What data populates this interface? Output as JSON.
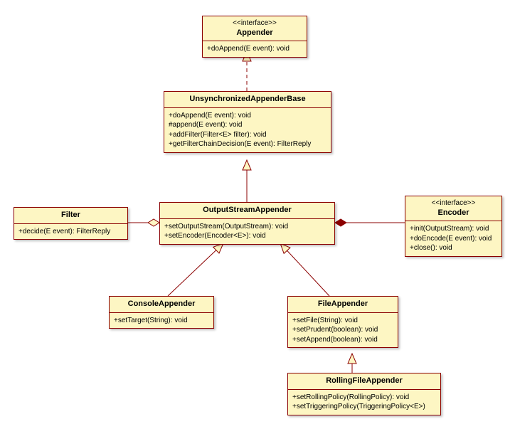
{
  "classes": {
    "appender": {
      "stereotype": "<<interface>>",
      "name": "Appender",
      "ops": [
        "+doAppend(E event): void"
      ]
    },
    "uab": {
      "name": "UnsynchronizedAppenderBase",
      "ops": [
        "+doAppend(E event): void",
        "#append(E event): void",
        "+addFilter(Filter<E> filter): void",
        "+getFilterChainDecision(E event): FilterReply"
      ]
    },
    "osa": {
      "name": "OutputStreamAppender",
      "ops": [
        "+setOutputStream(OutputStream): void",
        "+setEncoder(Encoder<E>): void"
      ]
    },
    "filter": {
      "name": "Filter",
      "ops": [
        "+decide(E event): FilterReply"
      ]
    },
    "encoder": {
      "stereotype": "<<interface>>",
      "name": "Encoder",
      "ops": [
        "+init(OutputStream): void",
        "+doEncode(E event): void",
        "+close(): void"
      ]
    },
    "console": {
      "name": "ConsoleAppender",
      "ops": [
        "+setTarget(String): void"
      ]
    },
    "file": {
      "name": "FileAppender",
      "ops": [
        "+setFile(String): void",
        "+setPrudent(boolean): void",
        "+setAppend(boolean): void"
      ]
    },
    "rolling": {
      "name": "RollingFileAppender",
      "ops": [
        "+setRollingPolicy(RollingPolicy): void",
        "+setTriggeringPolicy(TriggeringPolicy<E>)"
      ]
    }
  }
}
